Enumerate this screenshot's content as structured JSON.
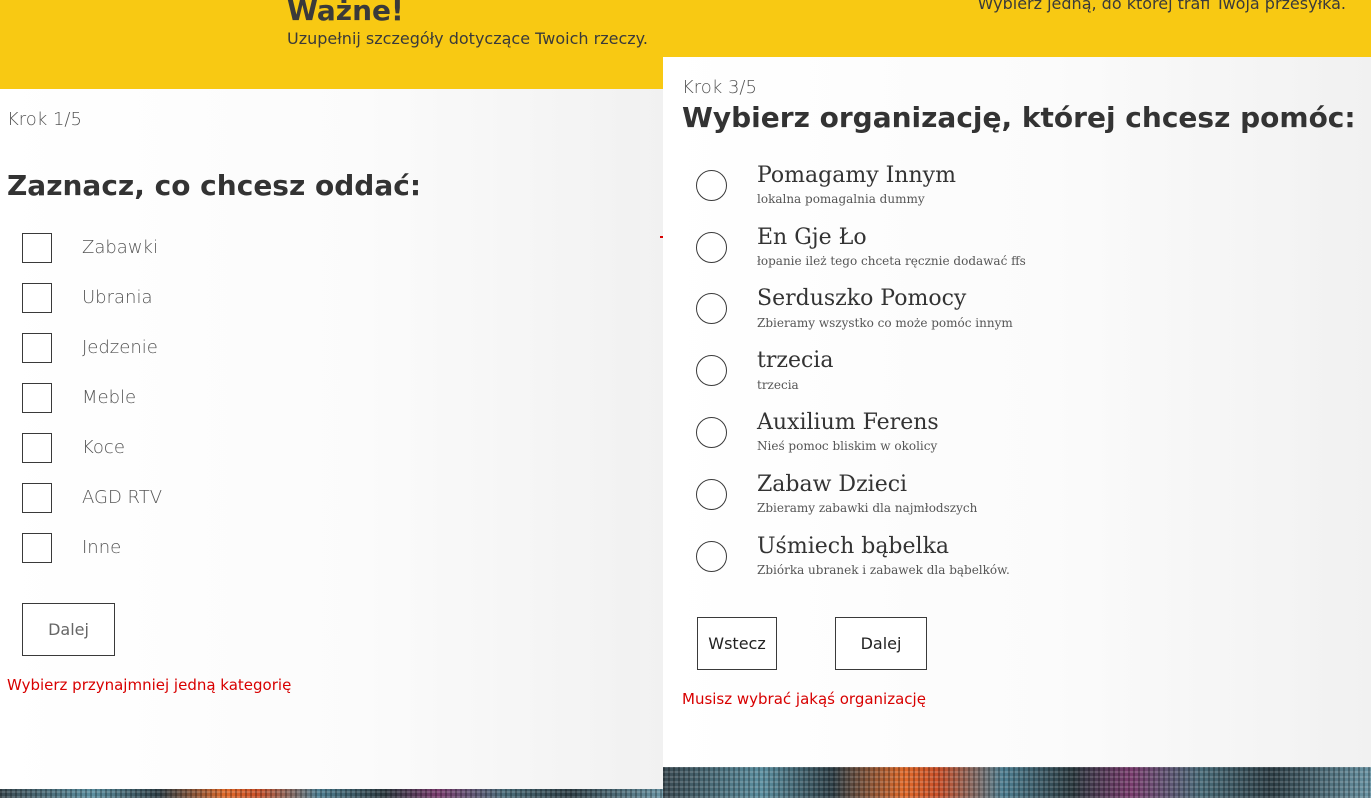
{
  "left_panel": {
    "banner": {
      "title": "Ważne!",
      "text": "Uzupełnij szczegóły dotyczące Twoich rzeczy."
    },
    "step": "Krok 1/5",
    "heading": "Zaznacz, co chcesz oddać:",
    "categories": [
      {
        "label": "Zabawki"
      },
      {
        "label": "Ubrania"
      },
      {
        "label": "Jedzenie"
      },
      {
        "label": "Meble"
      },
      {
        "label": "Koce"
      },
      {
        "label": "AGD RTV"
      },
      {
        "label": "Inne"
      }
    ],
    "next_button": "Dalej",
    "error": "Wybierz przynajmniej jedną kategorię"
  },
  "right_panel": {
    "banner": {
      "text": "Wybierz jedną, do której trafi Twoja przesyłka."
    },
    "step": "Krok 3/5",
    "heading": "Wybierz organizację, której chcesz pomóc:",
    "organizations": [
      {
        "name": "Pomagamy Innym",
        "description": "lokalna pomagalnia dummy"
      },
      {
        "name": "En Gje Ło",
        "description": "łopanie ileż tego chceta ręcznie dodawać ffs"
      },
      {
        "name": "Serduszko Pomocy",
        "description": "Zbieramy wszystko co może pomóc innym"
      },
      {
        "name": "trzecia",
        "description": "trzecia"
      },
      {
        "name": "Auxilium Ferens",
        "description": "Nieś pomoc bliskim w okolicy"
      },
      {
        "name": "Zabaw Dzieci",
        "description": "Zbieramy zabawki dla najmłodszych"
      },
      {
        "name": "Uśmiech bąbelka",
        "description": "Zbiórka ubranek i zabawek dla bąbelków."
      }
    ],
    "back_button": "Wstecz",
    "next_button": "Dalej",
    "error": "Musisz wybrać jakąś organizację"
  },
  "colors": {
    "banner": "#f8c913",
    "error": "#d80000",
    "text": "#333333"
  }
}
